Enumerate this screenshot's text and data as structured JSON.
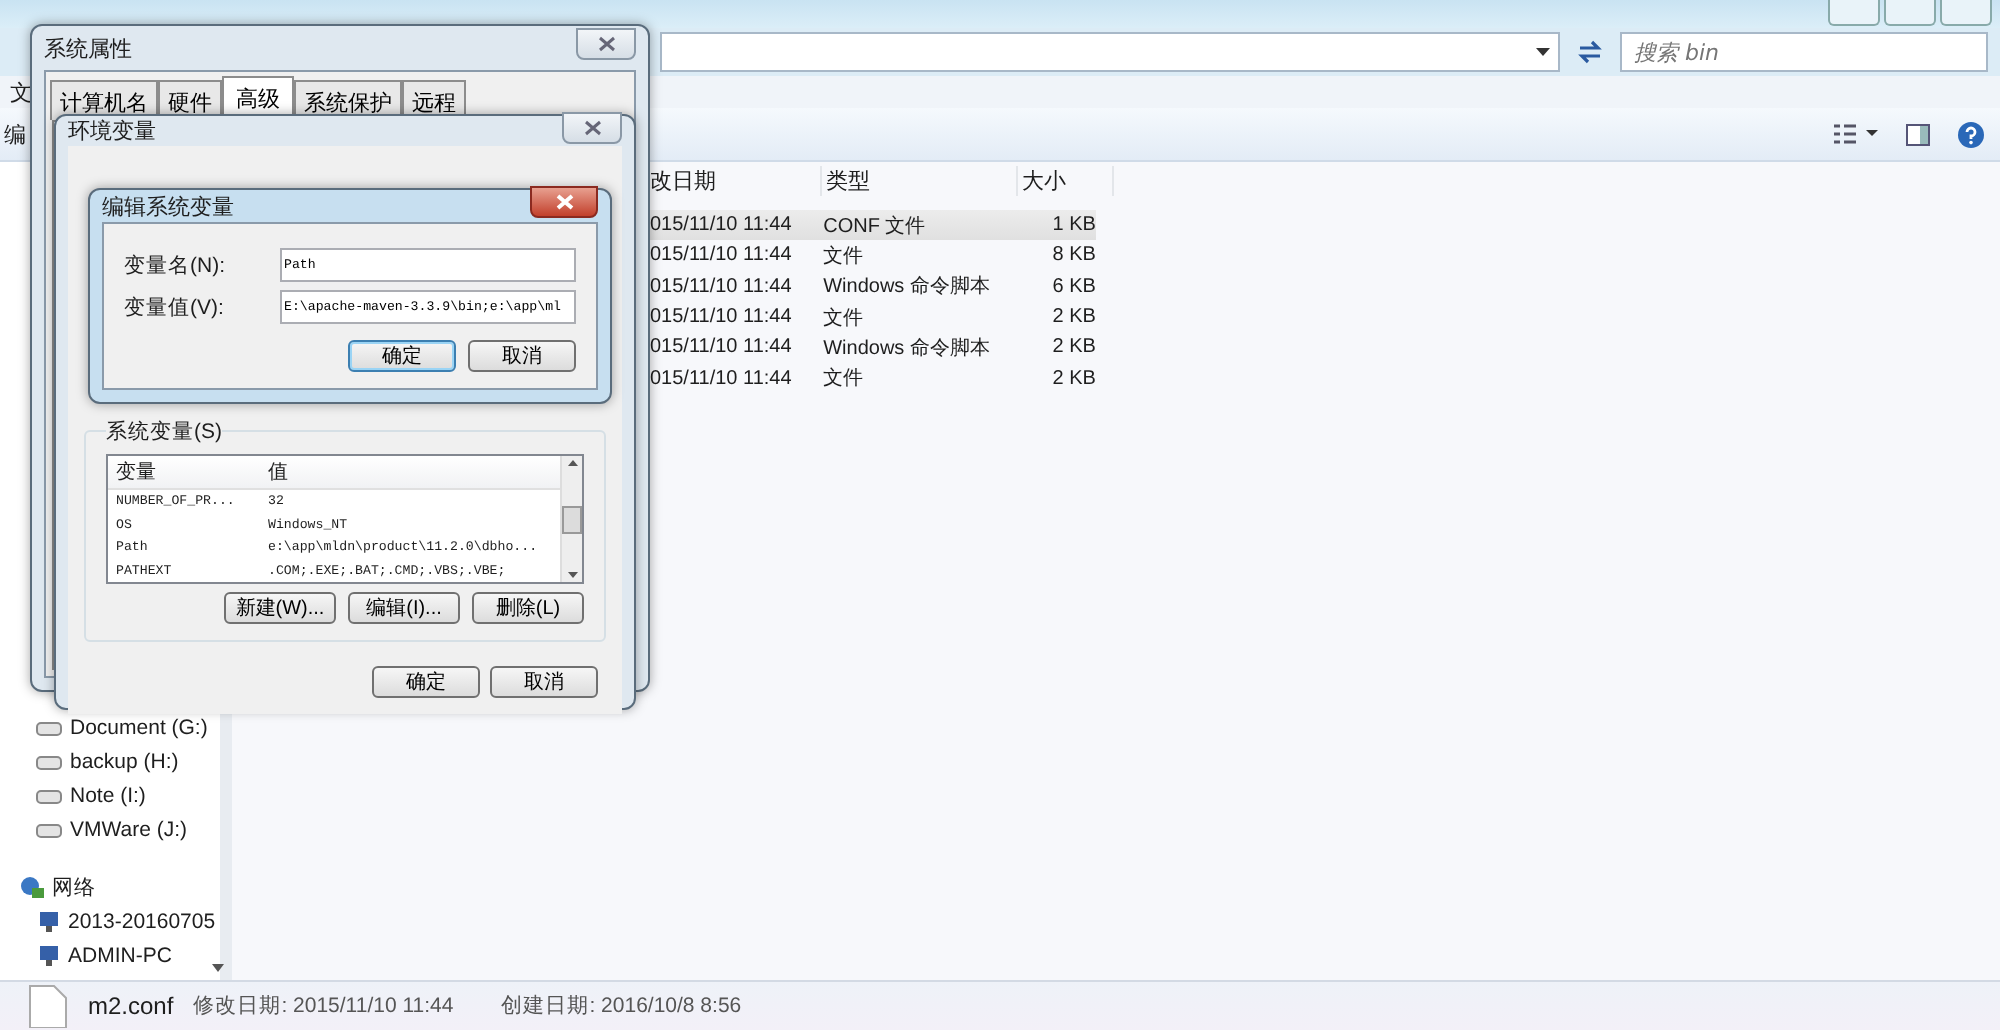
{
  "explorer": {
    "search_placeholder": "搜索 bin",
    "menu_fragment": "文",
    "toolbar_fragment": "编",
    "columns": [
      "改日期",
      "类型",
      "大小"
    ],
    "files": [
      {
        "date": "015/11/10 11:44",
        "type": "CONF 文件",
        "size": "1 KB",
        "selected": true
      },
      {
        "date": "015/11/10 11:44",
        "type": "文件",
        "size": "8 KB",
        "selected": false
      },
      {
        "date": "015/11/10 11:44",
        "type": "Windows 命令脚本",
        "size": "6 KB",
        "selected": false
      },
      {
        "date": "015/11/10 11:44",
        "type": "文件",
        "size": "2 KB",
        "selected": false
      },
      {
        "date": "015/11/10 11:44",
        "type": "Windows 命令脚本",
        "size": "2 KB",
        "selected": false
      },
      {
        "date": "015/11/10 11:44",
        "type": "文件",
        "size": "2 KB",
        "selected": false
      }
    ],
    "nav": [
      {
        "label": "Document (G:)",
        "kind": "drive"
      },
      {
        "label": "backup (H:)",
        "kind": "drive"
      },
      {
        "label": "Note (I:)",
        "kind": "drive"
      },
      {
        "label": "VMWare (J:)",
        "kind": "drive"
      },
      {
        "label": "网络",
        "kind": "network",
        "children": [
          {
            "label": "2013-20160705",
            "kind": "computer"
          },
          {
            "label": "ADMIN-PC",
            "kind": "computer"
          }
        ]
      }
    ],
    "details": {
      "name": "m2.conf",
      "modified": "修改日期: 2015/11/10 11:44",
      "created": "创建日期: 2016/10/8 8:56"
    }
  },
  "system_properties": {
    "title": "系统属性",
    "tabs": [
      {
        "label": "计算机名",
        "selected": false
      },
      {
        "label": "硬件",
        "selected": false
      },
      {
        "label": "高级",
        "selected": true
      },
      {
        "label": "系统保护",
        "selected": false
      },
      {
        "label": "远程",
        "selected": false
      }
    ]
  },
  "environment_variables": {
    "title": "环境变量",
    "group_label": "系统变量(S)",
    "columns": [
      "变量",
      "值"
    ],
    "rows": [
      {
        "name": "NUMBER_OF_PR...",
        "value": "32"
      },
      {
        "name": "OS",
        "value": "Windows_NT"
      },
      {
        "name": "Path",
        "value": "e:\\app\\mldn\\product\\11.2.0\\dbho..."
      },
      {
        "name": "PATHEXT",
        "value": ".COM;.EXE;.BAT;.CMD;.VBS;.VBE;"
      }
    ],
    "list_buttons": [
      "新建(W)...",
      "编辑(I)...",
      "删除(L)"
    ],
    "buttons": [
      "确定",
      "取消"
    ]
  },
  "edit_dialog": {
    "title": "编辑系统变量",
    "fields": [
      {
        "label": "变量名(N):",
        "value": "Path"
      },
      {
        "label": "变量值(V):",
        "value": "E:\\apache-maven-3.3.9\\bin;e:\\app\\ml"
      }
    ],
    "buttons": [
      "确定",
      "取消"
    ]
  }
}
